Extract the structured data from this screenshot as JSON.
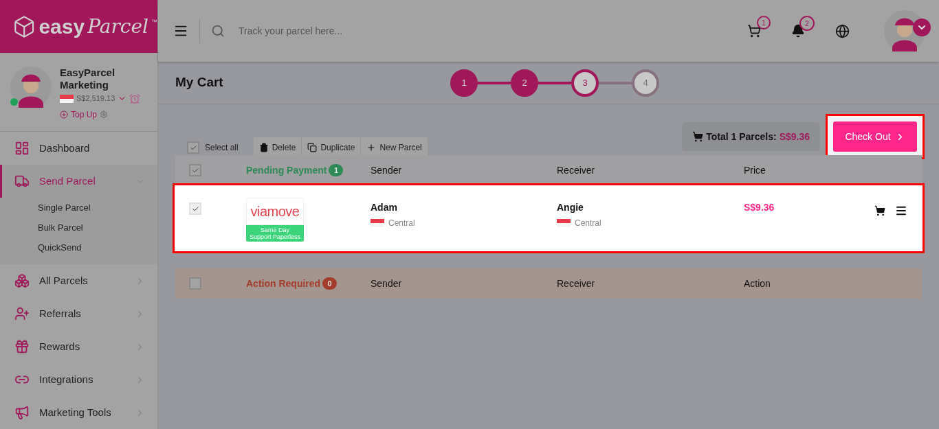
{
  "header": {
    "logo": {
      "word1": "easy",
      "word2": "Parcel",
      "mark": "™"
    },
    "search": {
      "placeholder": "Track your parcel here..."
    },
    "cart_badge": "1",
    "notification_badge": "2"
  },
  "profile": {
    "name": "EasyParcel Marketing",
    "balance": "S$2,519.13",
    "top_up": "Top Up",
    "online": true
  },
  "sidebar": {
    "items": [
      {
        "label": "Dashboard",
        "kind": "link",
        "selected": false,
        "expanded": false
      },
      {
        "label": "Send Parcel",
        "kind": "group",
        "selected": true,
        "expanded": true,
        "children": [
          {
            "label": "Single Parcel"
          },
          {
            "label": "Bulk Parcel"
          },
          {
            "label": "QuickSend"
          }
        ]
      },
      {
        "label": "All Parcels",
        "kind": "group",
        "selected": false,
        "expanded": false
      },
      {
        "label": "Referrals",
        "kind": "group",
        "selected": false,
        "expanded": false
      },
      {
        "label": "Rewards",
        "kind": "group",
        "selected": false,
        "expanded": false
      },
      {
        "label": "Integrations",
        "kind": "group",
        "selected": false,
        "expanded": false
      },
      {
        "label": "Marketing Tools",
        "kind": "group",
        "selected": false,
        "expanded": false
      }
    ]
  },
  "page": {
    "title": "My Cart",
    "steps": [
      {
        "label": "1",
        "completed": true,
        "selected": false
      },
      {
        "label": "2",
        "completed": true,
        "selected": false
      },
      {
        "label": "3",
        "completed": false,
        "selected": true
      },
      {
        "label": "4",
        "completed": false,
        "selected": false
      }
    ]
  },
  "toolbar": {
    "select_all": {
      "label": "Select all",
      "checked": true
    },
    "actions": [
      {
        "label": "Delete"
      },
      {
        "label": "Duplicate"
      },
      {
        "label": "New Parcel"
      }
    ]
  },
  "summary": {
    "label": "Total 1 Parcels:",
    "amount": "S$9.36"
  },
  "checkout": {
    "label": "Check Out",
    "highlighted": true
  },
  "sections": [
    {
      "kind": "pending",
      "title": "Pending Payment",
      "count": "1",
      "checked": true,
      "columns": [
        "Sender",
        "Receiver",
        "Price"
      ],
      "rows": [
        {
          "checked": true,
          "highlighted": true,
          "courier_logo": "viamove",
          "service_tags": [
            "Same Day",
            "Support Paperless"
          ],
          "sender": {
            "name": "Adam",
            "region": "Central"
          },
          "receiver": {
            "name": "Angie",
            "region": "Central"
          },
          "price": "S$9.36"
        }
      ]
    },
    {
      "kind": "action",
      "title": "Action Required",
      "count": "0",
      "checked": false,
      "columns": [
        "Sender",
        "Receiver",
        "Action"
      ]
    }
  ]
}
